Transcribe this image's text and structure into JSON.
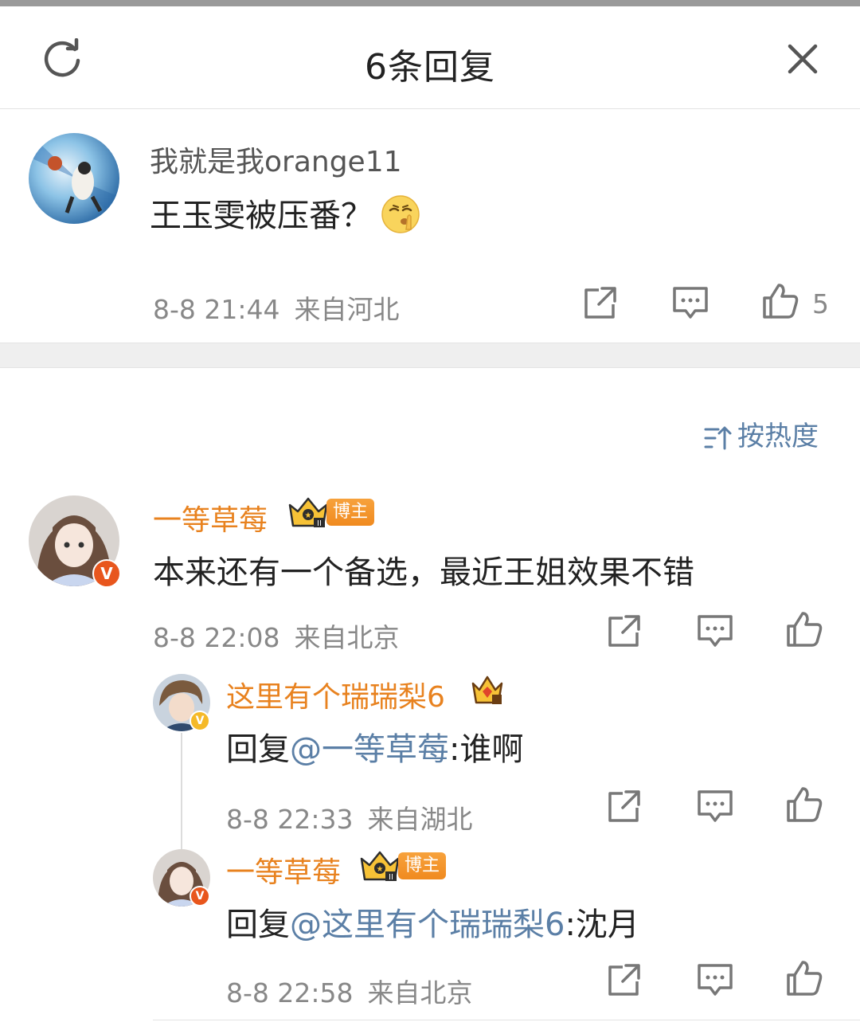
{
  "header": {
    "title": "6条回复"
  },
  "root_comment": {
    "username": "我就是我orange11",
    "text": "王玉雯被压番？",
    "emoji": "shush-emoji",
    "time": "8-8 21:44",
    "location": "来自河北",
    "likes": "5"
  },
  "sort": {
    "label": "按热度"
  },
  "replies": [
    {
      "username": "一等草莓",
      "badge": "博主",
      "text": "本来还有一个备选，最近王姐效果不错",
      "time": "8-8 22:08",
      "location": "来自北京"
    },
    {
      "username": "这里有个瑞瑞梨6",
      "reply_prefix": "回复",
      "mention": "@一等草莓",
      "text": ":谁啊",
      "time": "8-8 22:33",
      "location": "来自湖北"
    },
    {
      "username": "一等草莓",
      "badge": "博主",
      "reply_prefix": "回复",
      "mention": "@这里有个瑞瑞梨6",
      "text": ":沈月",
      "time": "8-8 22:58",
      "location": "来自北京"
    }
  ],
  "colors": {
    "accent_orange": "#e8821f",
    "link_blue": "#5b7fa6",
    "meta_gray": "#888888"
  }
}
